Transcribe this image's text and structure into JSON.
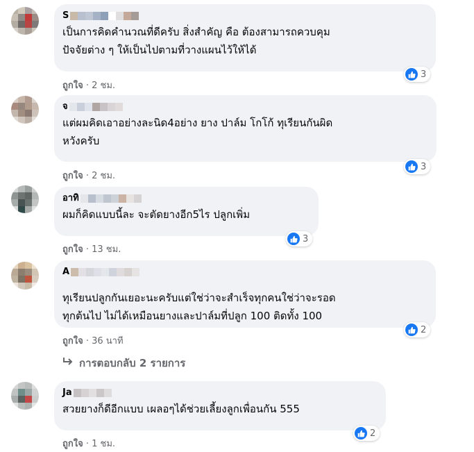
{
  "comments": [
    {
      "author": "S",
      "text_lines": [
        "เป็นการคิดคำนวณที่ดีครับ สิ่งสำคัญ คือ ต้องสามารถควบคุม",
        "ปัจจัยต่าง ๆ ให้เป็นไปตามที่วางแผนไว้ให้ได้"
      ],
      "like_label": "ถูกใจ",
      "time": "2 ชม.",
      "reactions": "3"
    },
    {
      "author": "จ",
      "text_lines": [
        "แต่ผมคิดเอาอย่างละนิด4อย่าง ยาง ปาล์ม โกโก้ ทุเรียนกันผิด",
        "หวังครับ"
      ],
      "like_label": "ถูกใจ",
      "time": "2 ชม.",
      "reactions": "3"
    },
    {
      "author": "อาทิ",
      "text_lines": [
        "ผมก็คิดแบบนี้ละ จะตัดยางอีก5ไร ปลูกเพิ่ม"
      ],
      "like_label": "ถูกใจ",
      "time": "13 ชม.",
      "reactions": "3"
    },
    {
      "author": "A",
      "text_lines": [
        "ทุเรียนปลูกกันเยอะนะครับแต่ใช่ว่าจะสำเร็จทุกคนใช่ว่าจะรอด",
        "ทุกต้นไป ไม่ได้เหมือนยางและปาล์มที่ปลูก 100 ติดทั้ง 100"
      ],
      "like_label": "ถูกใจ",
      "time": "36 นาที",
      "reactions": "2"
    },
    {
      "author": "Ja",
      "text_lines": [
        "สวยยางก็ดีอีกแบบ เผลอๆได้ช่วยเลี้ยงลูกเพื่อนกัน 555"
      ],
      "like_label": "ถูกใจ",
      "time": "1 ชม.",
      "reactions": "2"
    }
  ],
  "replies_link": "การตอบกลับ 2 รายการ",
  "colors": {
    "like_blue": "#1877f2",
    "bubble_bg": "#f0f2f5",
    "meta_gray": "#65676b"
  },
  "icons": {
    "reaction": "like-icon",
    "reply_arrow": "reply-arrow-icon"
  }
}
